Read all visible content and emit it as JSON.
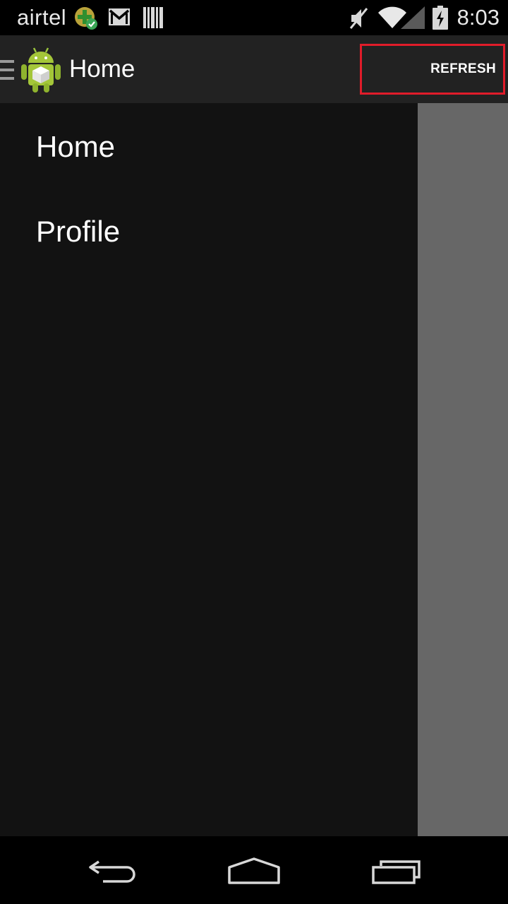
{
  "status_bar": {
    "carrier": "airtel",
    "time": "8:03",
    "icons": [
      "carrier-badge-icon",
      "gmail-icon",
      "barcode-icon",
      "mute-icon",
      "wifi-icon",
      "signal-icon",
      "battery-charging-icon"
    ]
  },
  "action_bar": {
    "title": "Home",
    "refresh_label": "REFRESH",
    "highlight_color": "#e01c2a",
    "icons": [
      "drawer-toggle-icon",
      "android-logo-icon"
    ]
  },
  "drawer": {
    "items": [
      {
        "label": "Home"
      },
      {
        "label": "Profile"
      }
    ]
  },
  "nav_bar": {
    "icons": [
      "back-icon",
      "home-icon",
      "recent-apps-icon"
    ]
  }
}
